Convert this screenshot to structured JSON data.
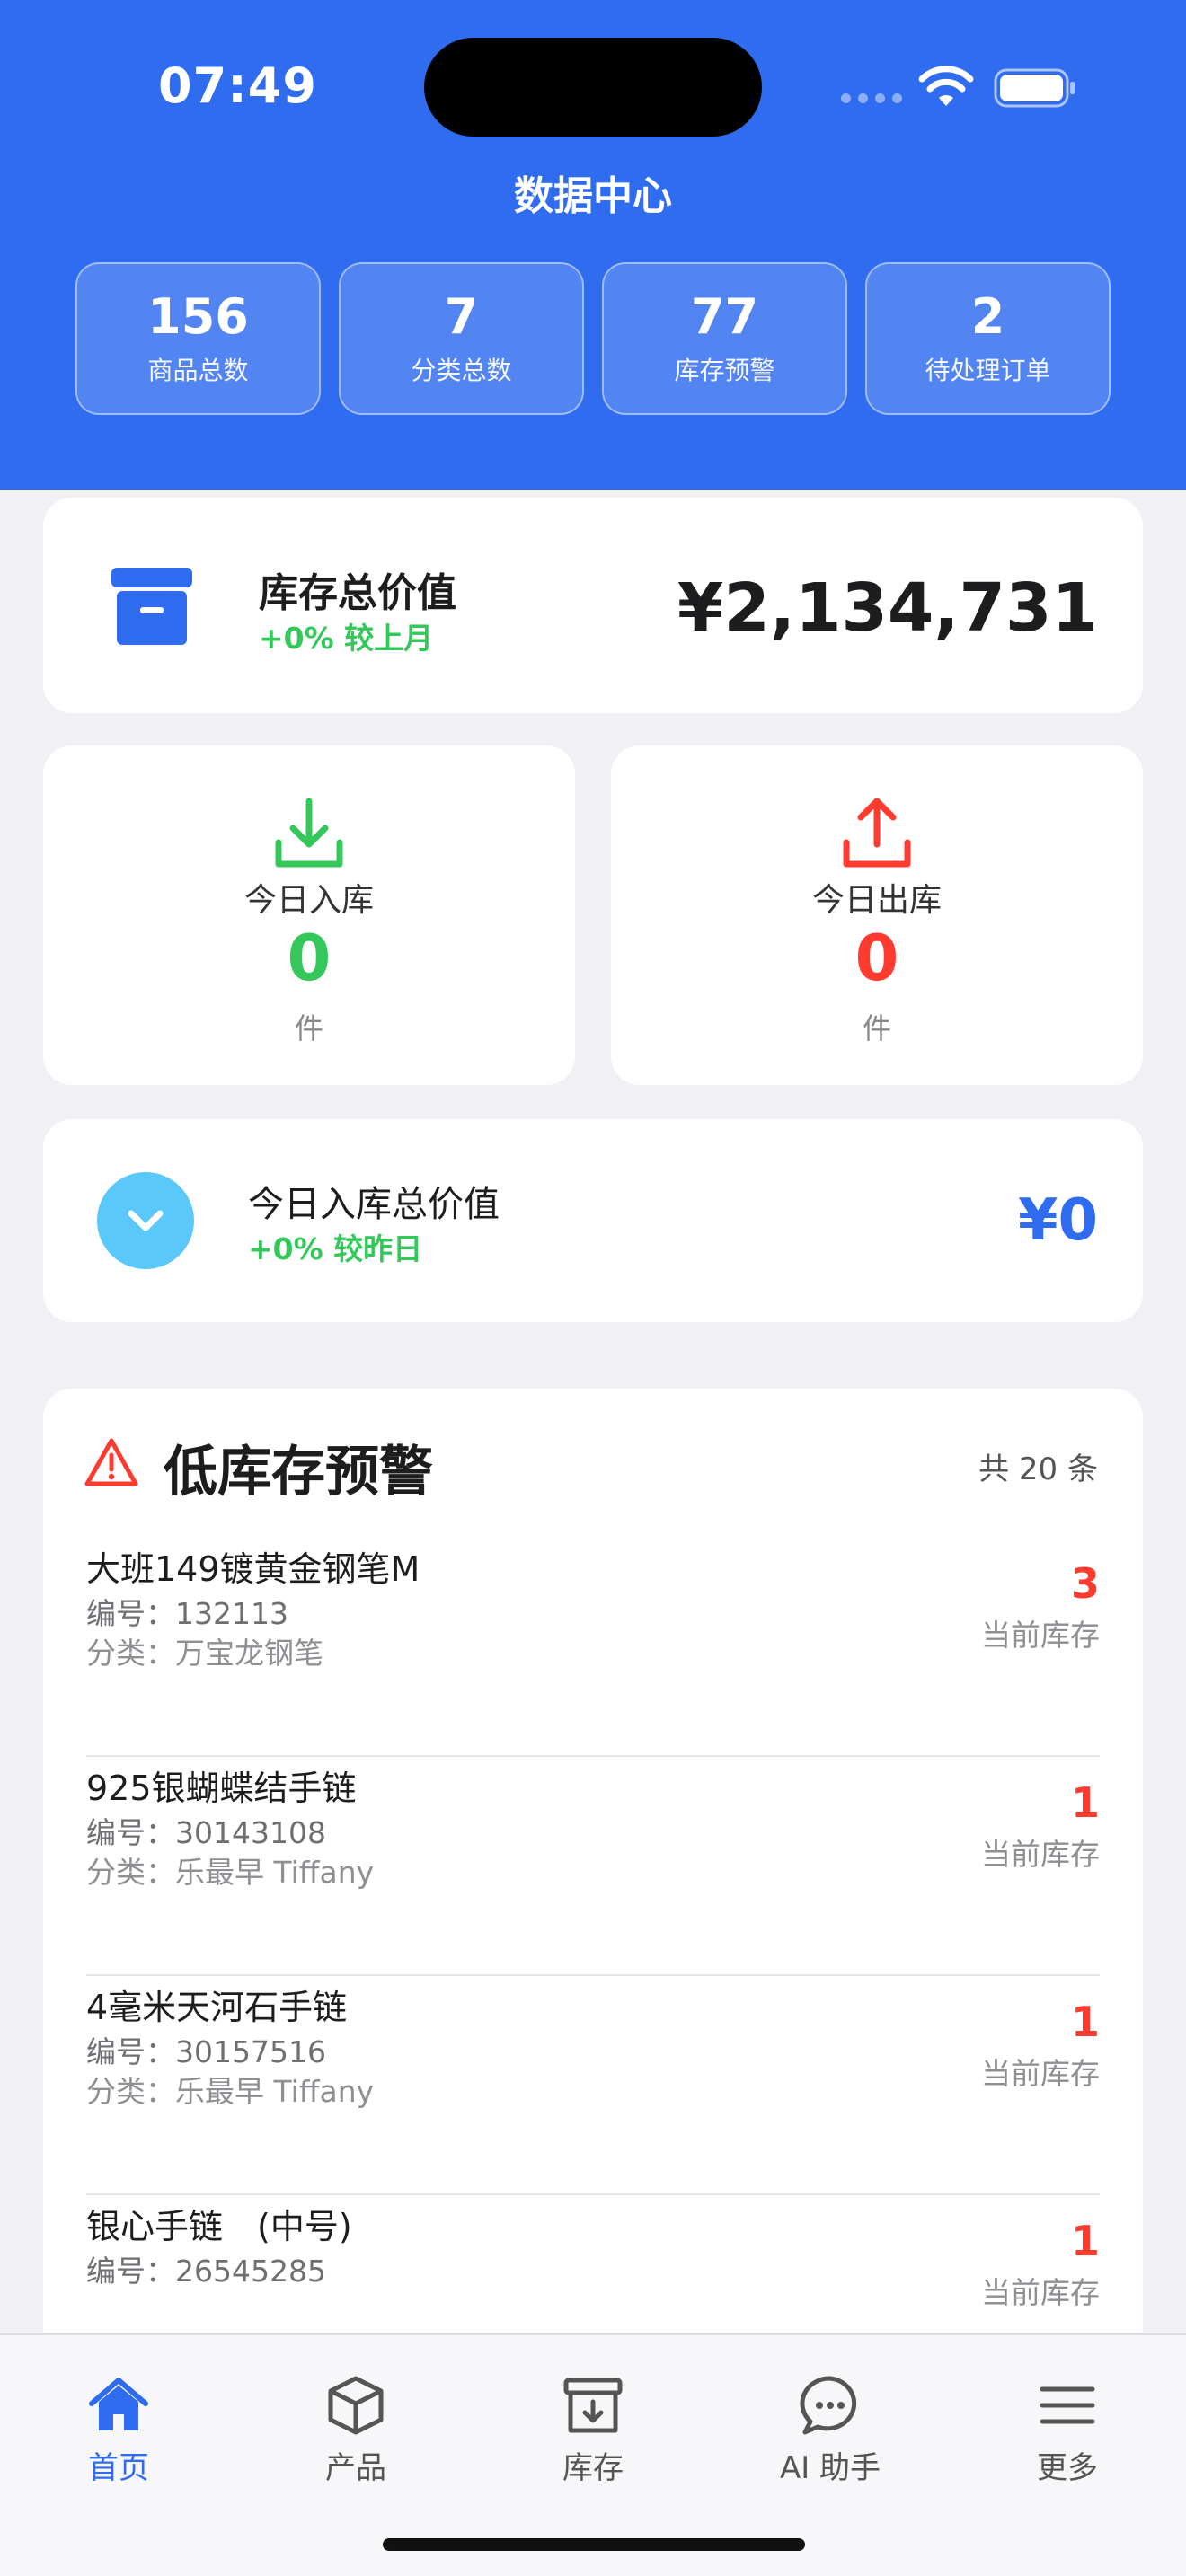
{
  "status_bar": {
    "time": "07:49"
  },
  "header": {
    "title": "数据中心"
  },
  "stats": [
    {
      "value": "156",
      "label": "商品总数"
    },
    {
      "value": "7",
      "label": "分类总数"
    },
    {
      "value": "77",
      "label": "库存预警"
    },
    {
      "value": "2",
      "label": "待处理订单"
    }
  ],
  "inventory": {
    "title": "库存总价值",
    "change": "+0% 较上月",
    "value": "¥2,134,731"
  },
  "today_in": {
    "label": "今日入库",
    "count": "0",
    "unit": "件"
  },
  "today_out": {
    "label": "今日出库",
    "count": "0",
    "unit": "件"
  },
  "today_value": {
    "title": "今日入库总价值",
    "change": "+0% 较昨日",
    "value": "¥0"
  },
  "low_stock": {
    "title": "低库存预警",
    "count": "共 20 条",
    "qty_label": "当前库存",
    "items": [
      {
        "name": "大班149镀黄金钢笔M",
        "code": "编号：132113",
        "category": "分类：万宝龙钢笔",
        "qty": "3"
      },
      {
        "name": "925银蝴蝶结手链",
        "code": "编号：30143108",
        "category": "分类：乐最早 Tiffany",
        "qty": "1"
      },
      {
        "name": "4毫米天河石手链",
        "code": "编号：30157516",
        "category": "分类：乐最早 Tiffany",
        "qty": "1"
      },
      {
        "name": "银心手链　(中号)",
        "code": "编号：26545285",
        "category": "",
        "qty": "1"
      }
    ]
  },
  "tabbar": [
    {
      "label": "首页",
      "icon": "home-icon",
      "active": true
    },
    {
      "label": "产品",
      "icon": "cube-icon"
    },
    {
      "label": "库存",
      "icon": "archive-icon"
    },
    {
      "label": "AI 助手",
      "icon": "chat-icon"
    },
    {
      "label": "更多",
      "icon": "menu-icon"
    }
  ],
  "colors": {
    "primary": "#2f6cf0",
    "success": "#34c759",
    "danger": "#ff3b30"
  }
}
